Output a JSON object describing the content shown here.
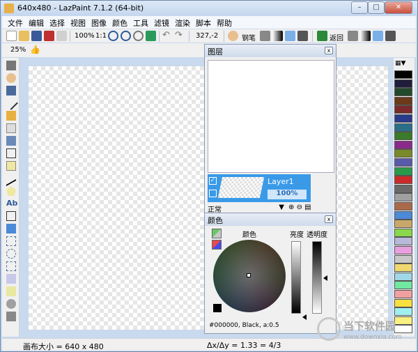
{
  "window": {
    "title": "640x480 - LazPaint 7.1.2 (64-bit)",
    "controls": {
      "minimize": "–",
      "maximize": "□",
      "close": "✕"
    }
  },
  "menu": [
    "文件",
    "编辑",
    "选择",
    "视图",
    "图像",
    "颜色",
    "工具",
    "滤镜",
    "渲染",
    "脚本",
    "帮助"
  ],
  "toolbar": {
    "zoom": "100%",
    "ratio": "1:1",
    "coords": "327,-2",
    "pen_label": "钢笔",
    "back_label": "返回"
  },
  "toolbar2": {
    "zoom_small": "25%"
  },
  "layers_panel": {
    "title": "图层",
    "layer_name": "Layer1",
    "opacity": "100%",
    "blend_mode": "正常",
    "close": "x"
  },
  "color_panel": {
    "title": "颜色",
    "label_color": "颜色",
    "label_brightness": "亮度",
    "label_opacity": "透明度",
    "info": "#000000, Black, a:0.5",
    "close": "x"
  },
  "palette_colors": [
    "#000000",
    "#1e1e3c",
    "#224a2a",
    "#6b3a1a",
    "#7a2a2a",
    "#2a3a8a",
    "#2a6e8a",
    "#3a7a2a",
    "#8a2a8a",
    "#7a8a2a",
    "#5a5aaa",
    "#2a9a4a",
    "#cc2a2a",
    "#6a6a6a",
    "#a0a0a0",
    "#aa6a4a",
    "#4a8ad8",
    "#c8a86a",
    "#8ad84a",
    "#b8b8d8",
    "#e8a0e0",
    "#c8c8c8",
    "#f0d870",
    "#a0d8e8",
    "#70e8a0",
    "#f0a0a0",
    "#f8e040",
    "#a0f0f0",
    "#f8f080",
    "#ffffff"
  ],
  "status": {
    "canvas_size": "画布大小 = 640 x 480",
    "delta": "Δx/Δy = 1.33 = 4/3"
  },
  "watermark": {
    "text": "当下软件园",
    "url": "www.downxia.com"
  }
}
